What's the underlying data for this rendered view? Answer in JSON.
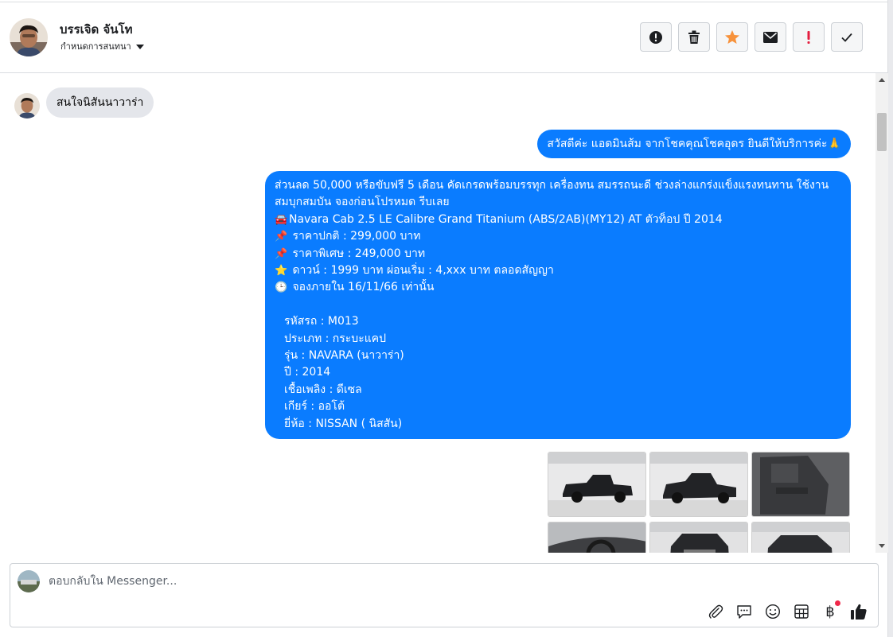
{
  "header": {
    "name": "บรรเจิด จันโท",
    "assign_label": "กำหนดการสนทนา"
  },
  "actions": [
    {
      "icon": "alert-circle-icon"
    },
    {
      "icon": "trash-icon"
    },
    {
      "icon": "star-icon",
      "color": "#f7923b"
    },
    {
      "icon": "envelope-icon"
    },
    {
      "icon": "exclamation-icon",
      "color": "#e41e3f"
    },
    {
      "icon": "checkmark-icon"
    }
  ],
  "messages": {
    "incoming_1": "สนใจนิสันนาวาร่า",
    "outgoing_1": "สวัสดีค่ะ แอดมินส้ม จากโชคคุณโชคอุดร ยินดีให้บริการค่ะ🙏",
    "outgoing_2": {
      "intro": "ส่วนลด 50,000 หรือขับฟรี 5 เดือน คัดเกรดพร้อมบรรทุก เครื่องทน สมรรถนะดี ช่วงล่างแกร่งแข็งแรงทนทาน ใช้งานสมบุกสมบัน จองก่อนโปรหมด รีบเลย",
      "model": "Navara Cab 2.5 LE Calibre Grand Titanium (ABS/2AB)(MY12) AT ตัวท็อป ปี 2014",
      "normal_price": "ราคาปกติ : 299,000 บาท",
      "special_price": "ราคาพิเศษ : 249,000 บาท",
      "down_payment": "ดาวน์ : 1999 บาท ผ่อนเริ่ม : 4,xxx บาท ตลอดสัญญา",
      "deadline": "จองภายใน 16/11/66 เท่านั้น",
      "code": "รหัสรถ : M013",
      "type": "ประเภท : กระบะแคป",
      "series": "รุ่น : NAVARA (นาวาร่า)",
      "year": "ปี : 2014",
      "fuel": "เชื้อเพลิง : ดีเซล",
      "gear": "เกียร์ : ออโต้",
      "brand": "ยี่ห้อ : NISSAN ( นิสสัน)"
    },
    "emojis": {
      "car": "🚘",
      "pin": "📌",
      "star": "⭐",
      "clock": "🕒"
    }
  },
  "photos": [
    {
      "subject": "black-pickup-side-left"
    },
    {
      "subject": "black-pickup-side-front"
    },
    {
      "subject": "door-interior"
    },
    {
      "subject": "dashboard-interior"
    },
    {
      "subject": "pickup-front"
    },
    {
      "subject": "pickup-front-angle"
    }
  ],
  "composer": {
    "placeholder": "ตอบกลับใน Messenger...",
    "tools": [
      "paperclip-icon",
      "chat-bubble-icon",
      "smiley-icon",
      "table-icon",
      "baht-icon",
      "thumbs-up-icon"
    ],
    "baht_symbol": "฿"
  },
  "colors": {
    "outgoing_bubble": "#0a7cff",
    "incoming_bubble": "#e4e6eb",
    "star": "#f7923b",
    "exclamation": "#e41e3f"
  }
}
